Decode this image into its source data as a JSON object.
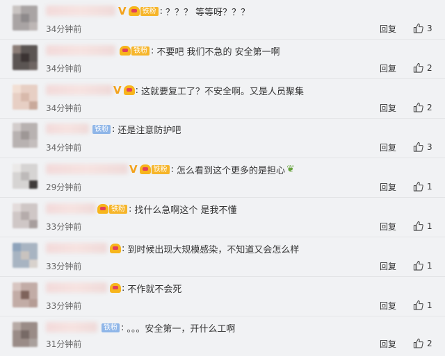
{
  "labels": {
    "reply": "回复",
    "fan_badge": "铁粉"
  },
  "icons": {
    "like": "thumbs-up-icon",
    "verified": "v-verified-icon",
    "crown": "crown-badge-icon"
  },
  "colors": {
    "background": "#f1f2f4",
    "verified": "#f3a21b",
    "fan_gold": "#f6b52a",
    "fan_blue": "#8fb6e8"
  },
  "comments": [
    {
      "text": "？？？ 等等呀？？？",
      "time": "34分钟前",
      "likes": "3"
    },
    {
      "text": "不要吧 我们不急的 安全第一啊",
      "time": "34分钟前",
      "likes": "2"
    },
    {
      "text": "这就要复工了？不安全啊。又是人员聚集",
      "time": "34分钟前",
      "likes": "2"
    },
    {
      "text": "还是注意防护吧",
      "time": "34分钟前",
      "likes": "3"
    },
    {
      "text": "怎么看到这个更多的是担心",
      "time": "29分钟前",
      "likes": "1"
    },
    {
      "text": "找什么急啊这个  是我不懂",
      "time": "33分钟前",
      "likes": "1"
    },
    {
      "text": "到时候出现大规模感染，不知道又会怎么样",
      "time": "33分钟前",
      "likes": "1"
    },
    {
      "text": "不作就不会死",
      "time": "33分钟前",
      "likes": "1"
    },
    {
      "text": "。。。安全第一，开什么工啊",
      "time": "31分钟前",
      "likes": "2"
    }
  ]
}
